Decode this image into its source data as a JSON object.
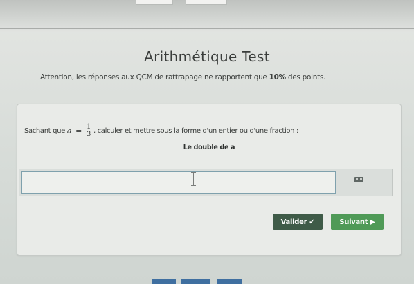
{
  "page": {
    "title": "Arithmétique Test",
    "warning_prefix": "Attention, les réponses aux QCM de rattrapage ne rapportent que ",
    "warning_bold": "10%",
    "warning_suffix": " des points."
  },
  "question": {
    "prefix": "Sachant que ",
    "variable": "a",
    "equals": "=",
    "fraction_numerator": "1",
    "fraction_denominator": "3",
    "suffix": ", calculer et mettre sous la forme d'un entier ou d'une fraction :",
    "subtitle": "Le double de a"
  },
  "answer": {
    "value": "",
    "keyboard_icon": "keyboard-icon"
  },
  "actions": {
    "validate_label": "Valider",
    "validate_icon": "✔",
    "next_label": "Suivant",
    "next_icon": "▶"
  },
  "colors": {
    "validate_bg": "#3f5b48",
    "next_bg": "#4f9a57",
    "input_border": "#7fa1ad",
    "nav_tab": "#3f6fa0"
  }
}
